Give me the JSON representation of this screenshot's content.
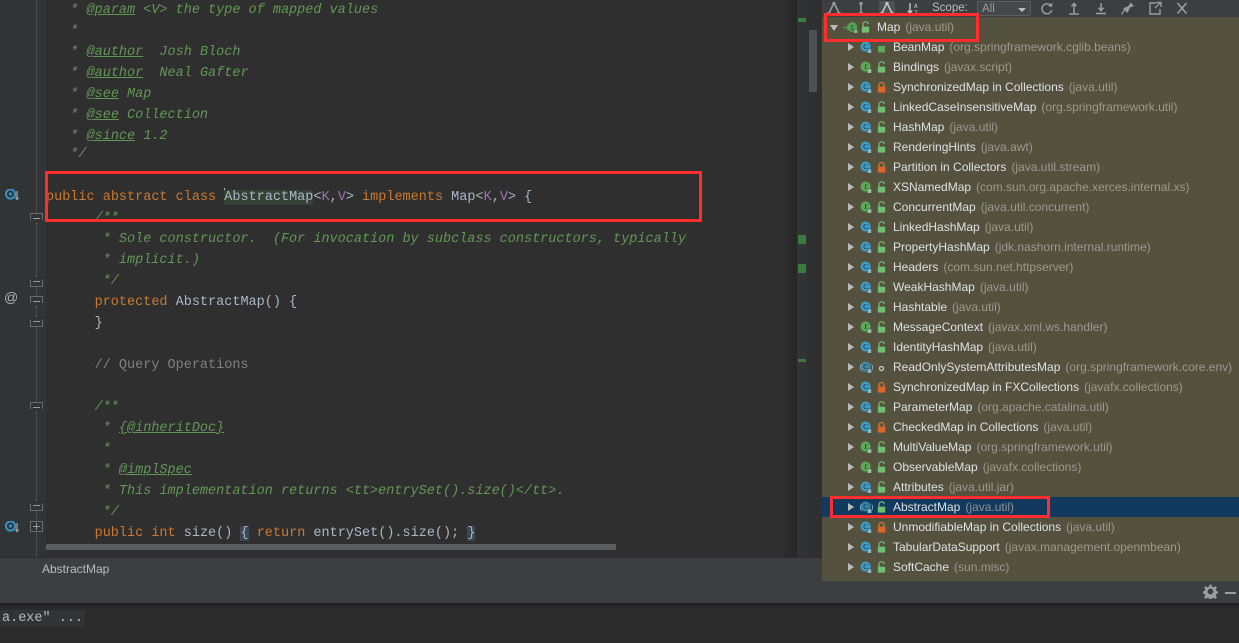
{
  "editor": {
    "lines": [
      {
        "indent": 0,
        "parts": [
          {
            "t": "   * ",
            "c": "cmt"
          },
          {
            "t": "@param",
            "c": "cmtu"
          },
          {
            "t": " <V> the type of mapped values",
            "c": "cmt"
          }
        ]
      },
      {
        "indent": 0,
        "parts": [
          {
            "t": "   *",
            "c": "cmt"
          }
        ]
      },
      {
        "indent": 0,
        "parts": [
          {
            "t": "   * ",
            "c": "cmt"
          },
          {
            "t": "@author",
            "c": "cmtu"
          },
          {
            "t": "  Josh Bloch",
            "c": "cmt"
          }
        ]
      },
      {
        "indent": 0,
        "parts": [
          {
            "t": "   * ",
            "c": "cmt"
          },
          {
            "t": "@author",
            "c": "cmtu"
          },
          {
            "t": "  Neal Gafter",
            "c": "cmt"
          }
        ]
      },
      {
        "indent": 0,
        "parts": [
          {
            "t": "   * ",
            "c": "cmt"
          },
          {
            "t": "@see",
            "c": "cmtu"
          },
          {
            "t": " Map",
            "c": "cmt"
          }
        ]
      },
      {
        "indent": 0,
        "parts": [
          {
            "t": "   * ",
            "c": "cmt"
          },
          {
            "t": "@see",
            "c": "cmtu"
          },
          {
            "t": " Collection",
            "c": "cmt"
          }
        ]
      },
      {
        "indent": 0,
        "parts": [
          {
            "t": "   * ",
            "c": "cmt"
          },
          {
            "t": "@since",
            "c": "cmtu"
          },
          {
            "t": " 1.2",
            "c": "cmt"
          }
        ]
      },
      {
        "indent": 0,
        "parts": [
          {
            "t": "   */",
            "c": "cmt"
          }
        ]
      }
    ],
    "declaration": {
      "public": "public",
      "abstract": "abstract",
      "class": "class",
      "name": "AbstractMap",
      "generics_open": "<",
      "k": "K",
      "comma": ",",
      "v": "V",
      "generics_close": ">",
      "implements": "implements",
      "super": "Map",
      "brace": "{"
    },
    "body_lines": [
      {
        "parts": [
          {
            "t": "      /**",
            "c": "cmt"
          }
        ]
      },
      {
        "parts": [
          {
            "t": "       * Sole constructor.  (For invocation by subclass constructors, typically",
            "c": "cmt"
          }
        ]
      },
      {
        "parts": [
          {
            "t": "       * implicit.)",
            "c": "cmt"
          }
        ]
      },
      {
        "parts": [
          {
            "t": "       */",
            "c": "cmt"
          }
        ]
      },
      {
        "parts": [
          {
            "t": "      ",
            "c": "plain"
          },
          {
            "t": "protected",
            "c": "kw"
          },
          {
            "t": " AbstractMap() {",
            "c": "plain"
          }
        ]
      },
      {
        "parts": [
          {
            "t": "      }",
            "c": "plain"
          }
        ]
      },
      {
        "parts": [
          {
            "t": "",
            "c": "plain"
          }
        ]
      },
      {
        "parts": [
          {
            "t": "      // Query Operations",
            "c": "lcmt"
          }
        ]
      },
      {
        "parts": [
          {
            "t": "",
            "c": "plain"
          }
        ]
      },
      {
        "parts": [
          {
            "t": "      /**",
            "c": "cmt"
          }
        ]
      },
      {
        "parts": [
          {
            "t": "       * ",
            "c": "cmt"
          },
          {
            "t": "{@inheritDoc}",
            "c": "cmtu"
          }
        ]
      },
      {
        "parts": [
          {
            "t": "       *",
            "c": "cmt"
          }
        ]
      },
      {
        "parts": [
          {
            "t": "       * ",
            "c": "cmt"
          },
          {
            "t": "@implSpec",
            "c": "cmtu"
          }
        ]
      },
      {
        "parts": [
          {
            "t": "       * This implementation returns <tt>entrySet().size()</tt>.",
            "c": "cmt"
          }
        ]
      },
      {
        "parts": [
          {
            "t": "       */",
            "c": "cmt"
          }
        ]
      }
    ],
    "size_method": {
      "public": "public",
      "int": "int",
      "name": "size()",
      "open_brace": "{",
      "return": "return",
      "expr": "entrySet().size();",
      "close_brace": "}"
    },
    "breadcrumb": "AbstractMap"
  },
  "console": {
    "text": "a.exe\" ..."
  },
  "hierarchy": {
    "toolbar": {
      "scope_label": "Scope:",
      "scope_value": "All",
      "buttons": [
        {
          "name": "subtypes-hierarchy-icon",
          "title": "Subtypes Hierarchy"
        },
        {
          "name": "supertypes-hierarchy-icon",
          "title": "Supertypes Hierarchy"
        },
        {
          "name": "class-hierarchy-icon",
          "title": "Class Hierarchy"
        },
        {
          "name": "sort-alphabetically-icon",
          "title": "Sort Alphabetically"
        },
        {
          "name": "refresh-icon",
          "title": "Refresh"
        },
        {
          "name": "expand-all-icon",
          "title": "Expand All"
        },
        {
          "name": "collapse-all-icon",
          "title": "Collapse All"
        },
        {
          "name": "pin-tab-icon",
          "title": "Pin Tab"
        },
        {
          "name": "export-icon",
          "title": "Export"
        },
        {
          "name": "close-icon",
          "title": "Close"
        }
      ]
    },
    "rows": [
      {
        "name": "Map",
        "pkg": "(java.util)",
        "kind": "root-interface",
        "badge": "protected",
        "depth": 0,
        "expanded": true,
        "selected": false
      },
      {
        "name": "BeanMap",
        "pkg": "(org.springframework.cglib.beans)",
        "kind": "class",
        "badge": "package",
        "depth": 1,
        "expanded": false,
        "selected": false
      },
      {
        "name": "Bindings",
        "pkg": "(javax.script)",
        "kind": "interface",
        "badge": "protected",
        "depth": 1,
        "expanded": false,
        "selected": false
      },
      {
        "name": "SynchronizedMap in Collections",
        "pkg": "(java.util)",
        "kind": "class",
        "badge": "private",
        "depth": 1,
        "expanded": false,
        "selected": false
      },
      {
        "name": "LinkedCaseInsensitiveMap",
        "pkg": "(org.springframework.util)",
        "kind": "class",
        "badge": "protected",
        "depth": 1,
        "expanded": false,
        "selected": false
      },
      {
        "name": "HashMap",
        "pkg": "(java.util)",
        "kind": "class",
        "badge": "protected",
        "depth": 1,
        "expanded": false,
        "selected": false
      },
      {
        "name": "RenderingHints",
        "pkg": "(java.awt)",
        "kind": "class",
        "badge": "protected",
        "depth": 1,
        "expanded": false,
        "selected": false
      },
      {
        "name": "Partition in Collectors",
        "pkg": "(java.util.stream)",
        "kind": "class",
        "badge": "private",
        "depth": 1,
        "expanded": false,
        "selected": false
      },
      {
        "name": "XSNamedMap",
        "pkg": "(com.sun.org.apache.xerces.internal.xs)",
        "kind": "interface",
        "badge": "protected",
        "depth": 1,
        "expanded": false,
        "selected": false
      },
      {
        "name": "ConcurrentMap",
        "pkg": "(java.util.concurrent)",
        "kind": "interface",
        "badge": "protected",
        "depth": 1,
        "expanded": false,
        "selected": false
      },
      {
        "name": "LinkedHashMap",
        "pkg": "(java.util)",
        "kind": "class",
        "badge": "protected",
        "depth": 1,
        "expanded": false,
        "selected": false
      },
      {
        "name": "PropertyHashMap",
        "pkg": "(jdk.nashorn.internal.runtime)",
        "kind": "class",
        "badge": "protected",
        "depth": 1,
        "expanded": false,
        "selected": false
      },
      {
        "name": "Headers",
        "pkg": "(com.sun.net.httpserver)",
        "kind": "class",
        "badge": "protected",
        "depth": 1,
        "expanded": false,
        "selected": false
      },
      {
        "name": "WeakHashMap",
        "pkg": "(java.util)",
        "kind": "class",
        "badge": "protected",
        "depth": 1,
        "expanded": false,
        "selected": false
      },
      {
        "name": "Hashtable",
        "pkg": "(java.util)",
        "kind": "class",
        "badge": "protected",
        "depth": 1,
        "expanded": false,
        "selected": false
      },
      {
        "name": "MessageContext",
        "pkg": "(javax.xml.ws.handler)",
        "kind": "interface",
        "badge": "protected",
        "depth": 1,
        "expanded": false,
        "selected": false
      },
      {
        "name": "IdentityHashMap",
        "pkg": "(java.util)",
        "kind": "class",
        "badge": "protected",
        "depth": 1,
        "expanded": false,
        "selected": false
      },
      {
        "name": "ReadOnlySystemAttributesMap",
        "pkg": "(org.springframework.core.env)",
        "kind": "class-abstract",
        "badge": "public",
        "depth": 1,
        "expanded": false,
        "selected": false
      },
      {
        "name": "SynchronizedMap in FXCollections",
        "pkg": "(javafx.collections)",
        "kind": "class",
        "badge": "private",
        "depth": 1,
        "expanded": false,
        "selected": false
      },
      {
        "name": "ParameterMap",
        "pkg": "(org.apache.catalina.util)",
        "kind": "class",
        "badge": "protected",
        "depth": 1,
        "expanded": false,
        "selected": false
      },
      {
        "name": "CheckedMap in Collections",
        "pkg": "(java.util)",
        "kind": "class",
        "badge": "private",
        "depth": 1,
        "expanded": false,
        "selected": false
      },
      {
        "name": "MultiValueMap",
        "pkg": "(org.springframework.util)",
        "kind": "interface",
        "badge": "protected",
        "depth": 1,
        "expanded": false,
        "selected": false
      },
      {
        "name": "ObservableMap",
        "pkg": "(javafx.collections)",
        "kind": "interface",
        "badge": "protected",
        "depth": 1,
        "expanded": false,
        "selected": false
      },
      {
        "name": "Attributes",
        "pkg": "(java.util.jar)",
        "kind": "class",
        "badge": "protected",
        "depth": 1,
        "expanded": false,
        "selected": false
      },
      {
        "name": "AbstractMap",
        "pkg": "(java.util)",
        "kind": "class-abstract",
        "badge": "protected",
        "depth": 1,
        "expanded": false,
        "selected": true
      },
      {
        "name": "UnmodifiableMap in Collections",
        "pkg": "(java.util)",
        "kind": "class",
        "badge": "private",
        "depth": 1,
        "expanded": false,
        "selected": false
      },
      {
        "name": "TabularDataSupport",
        "pkg": "(javax.management.openmbean)",
        "kind": "class",
        "badge": "protected",
        "depth": 1,
        "expanded": false,
        "selected": false
      },
      {
        "name": "SoftCache",
        "pkg": "(sun.misc)",
        "kind": "class",
        "badge": "protected",
        "depth": 1,
        "expanded": false,
        "selected": false
      }
    ]
  },
  "colors": {
    "editor_bg": "#2f2f2f",
    "panel_bg": "#55513f",
    "selection_bg": "#123a5e",
    "annotation": "#ff2d2d",
    "keyword": "#cc7832",
    "comment": "#629755",
    "generic": "#9876aa",
    "vcs_added": "#3a7a3a"
  }
}
